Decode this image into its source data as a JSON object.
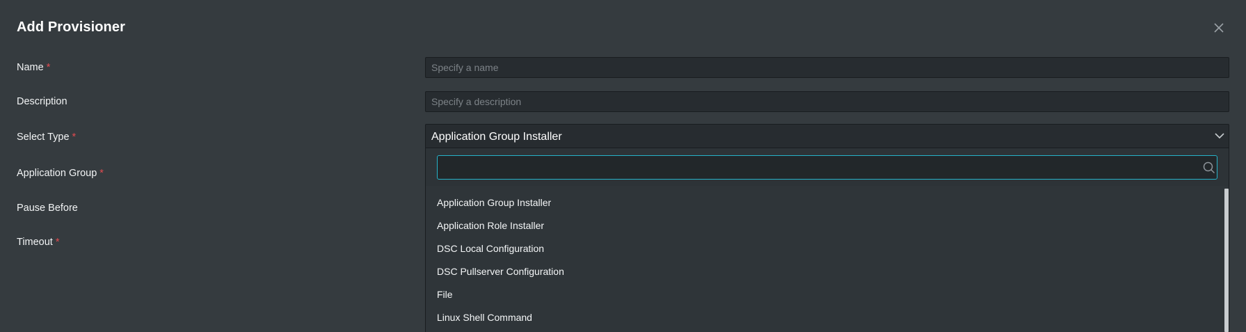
{
  "dialog": {
    "title": "Add Provisioner",
    "close_icon": "close-icon"
  },
  "form": {
    "name_label": "Name",
    "name_placeholder": "Specify a name",
    "description_label": "Description",
    "description_placeholder": "Specify a description",
    "type_label": "Select Type",
    "type_value": "Application Group Installer",
    "app_group_label": "Application Group",
    "pause_before_label": "Pause Before",
    "timeout_label": "Timeout",
    "required_marker": "*"
  },
  "dropdown": {
    "search_value": "",
    "search_icon": "search-icon",
    "options": [
      "Application Group Installer",
      "Application Role Installer",
      "DSC Local Configuration",
      "DSC Pullserver Configuration",
      "File",
      "Linux Shell Command"
    ]
  },
  "colors": {
    "background": "#353b3f",
    "input_bg": "#272c30",
    "required": "#e04b50",
    "focus_border": "#26b3c9"
  }
}
